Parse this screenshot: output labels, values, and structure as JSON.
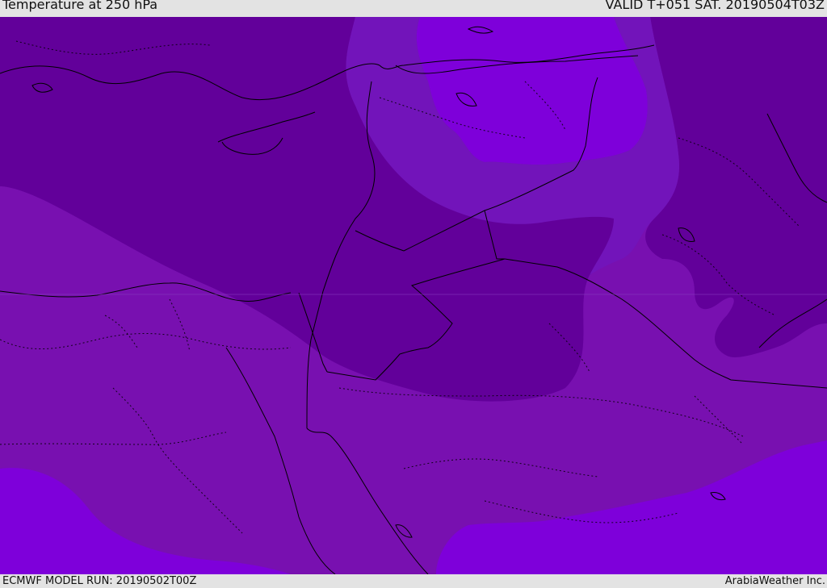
{
  "header": {
    "title": "Temperature at 250 hPa",
    "valid_time": "VALID T+051 SAT. 20190504T03Z"
  },
  "footer": {
    "model_run": "ECMWF MODEL RUN: 20190502T00Z",
    "credit": "ArabiaWeather Inc."
  },
  "colors": {
    "band_coldest": "#62009a",
    "band_mid": "#7810b0",
    "band_warm": "#7e00da",
    "borders": "#000000"
  }
}
